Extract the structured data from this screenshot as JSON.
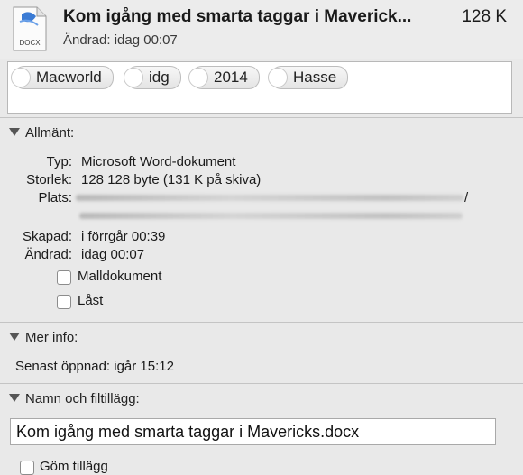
{
  "header": {
    "title": "Kom igång med smarta taggar i Maverick...",
    "size": "128 K",
    "modified": "Ändrad:  idag 00:07",
    "icon_label": "DOCX"
  },
  "tags": [
    "Macworld",
    "idg",
    "2014",
    "Hasse"
  ],
  "general": {
    "heading": "Allmänt:",
    "type_label": "Typ:",
    "type_value": "Microsoft Word-dokument",
    "size_label": "Storlek:",
    "size_value": "128 128 byte (131 K på skiva)",
    "location_label": "Plats:",
    "location_suffix": "/",
    "created_label": "Skapad:",
    "created_value": "i förrgår 00:39",
    "modified_label": "Ändrad:",
    "modified_value": "idag 00:07",
    "stationery_label": "Malldokument",
    "locked_label": "Låst"
  },
  "more_info": {
    "heading": "Mer info:",
    "last_opened": "Senast öppnad: igår 15:12"
  },
  "name_ext": {
    "heading": "Namn och filtillägg:",
    "filename": "Kom igång med smarta taggar i Mavericks.docx",
    "hide_extension_label": "Göm tillägg"
  }
}
